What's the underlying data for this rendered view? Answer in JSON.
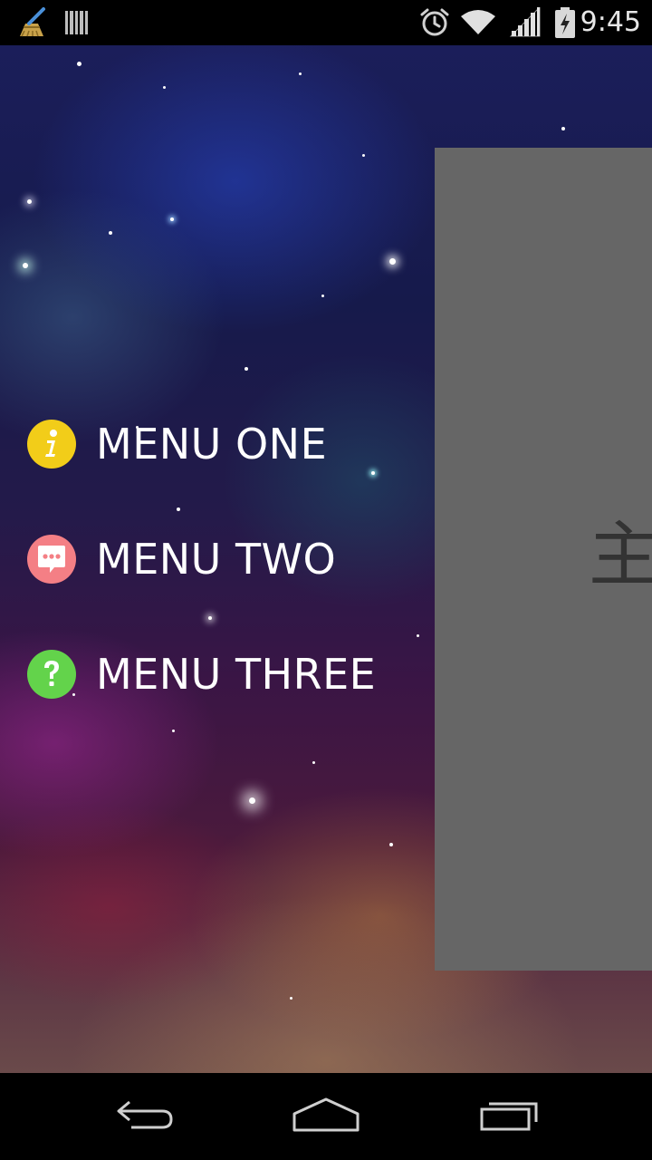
{
  "status_bar": {
    "time": "9:45",
    "icons": [
      "broom-cleaner-icon",
      "barcode-icon",
      "alarm-clock-icon",
      "wifi-icon",
      "signal-icon",
      "battery-charging-icon"
    ]
  },
  "menu": {
    "items": [
      {
        "label": "MENU ONE",
        "icon": "info-icon",
        "color": "#f2cd19"
      },
      {
        "label": "MENU TWO",
        "icon": "chat-bubble-icon",
        "color": "#f47f85"
      },
      {
        "label": "MENU THREE",
        "icon": "help-icon",
        "color": "#63d34b"
      }
    ]
  },
  "main": {
    "text": "主"
  },
  "colors": {
    "panel": "#666666",
    "status_bar": "#000000",
    "nav_bar": "#000000"
  },
  "nav_bar": {
    "buttons": [
      "back-icon",
      "home-icon",
      "recent-apps-icon"
    ]
  }
}
